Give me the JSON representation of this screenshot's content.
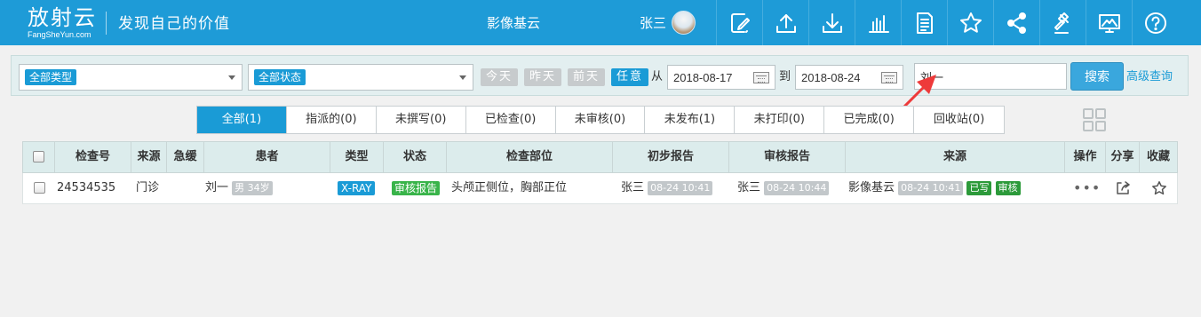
{
  "header": {
    "logo_text": "放射云",
    "logo_sub": "FangSheYun.com",
    "slogan": "发现自己的价值",
    "site_name": "影像基云",
    "username": "张三",
    "icons": [
      "edit-icon",
      "upload-icon",
      "download-icon",
      "bar-chart-icon",
      "document-icon",
      "star-icon",
      "share-icon",
      "gavel-icon",
      "monitor-icon",
      "help-icon"
    ]
  },
  "filters": {
    "type_select": "全部类型",
    "status_select": "全部状态",
    "quick_dates": [
      "今天",
      "昨天",
      "前天",
      "任意"
    ],
    "from_label": "从",
    "from_date": "2018-08-17",
    "to_label": "到",
    "to_date": "2018-08-24",
    "search_value": "刘一",
    "search_button": "搜索",
    "advanced_link": "高级查询"
  },
  "tabs": [
    {
      "label": "全部(1)",
      "active": true
    },
    {
      "label": "指派的(0)"
    },
    {
      "label": "未撰写(0)"
    },
    {
      "label": "已检查(0)"
    },
    {
      "label": "未审核(0)"
    },
    {
      "label": "未发布(1)"
    },
    {
      "label": "未打印(0)"
    },
    {
      "label": "已完成(0)"
    },
    {
      "label": "回收站(0)"
    }
  ],
  "table": {
    "headers": [
      "检查号",
      "来源",
      "急缓",
      "患者",
      "类型",
      "状态",
      "检查部位",
      "初步报告",
      "审核报告",
      "来源",
      "操作",
      "分享",
      "收藏"
    ],
    "rows": [
      {
        "exam_no": "24534535",
        "source": "门诊",
        "urgency": "",
        "patient_name": "刘一",
        "patient_info": "男 34岁",
        "modality": "X-RAY",
        "status": "审核报告",
        "body_part": "头颅正侧位，胸部正位",
        "prelim_doctor": "张三",
        "prelim_time": "08-24 10:41",
        "review_doctor": "张三",
        "review_time": "08-24 10:44",
        "origin": "影像基云",
        "origin_time": "08-24 10:41",
        "tag_written": "已写",
        "tag_reviewed": "审核",
        "ops": "•••"
      }
    ]
  },
  "colors": {
    "header_bg": "#1e9bd7",
    "accent": "#1a9bd6",
    "status_green": "#39b44a",
    "arrow_red": "#ee3a3a"
  }
}
